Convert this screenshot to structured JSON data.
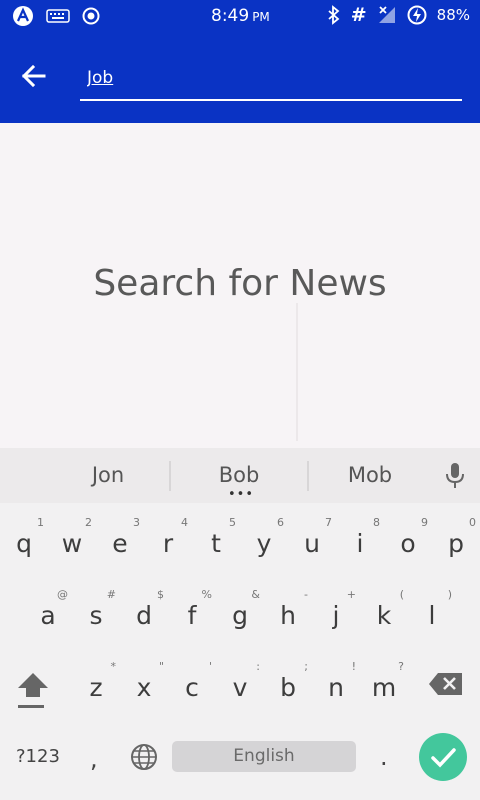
{
  "status_bar": {
    "time": "8:49",
    "ampm": "PM",
    "battery": "88%",
    "icons": [
      "app-icon",
      "keyboard-icon",
      "record-icon",
      "bluetooth-icon",
      "hash-icon",
      "no-signal-icon",
      "battery-charging-icon"
    ]
  },
  "app_bar": {
    "back_icon": "arrow-left-icon",
    "search_value": "Job"
  },
  "content": {
    "empty_message": "Search for News"
  },
  "keyboard": {
    "suggestions": [
      "Jon",
      "Bob",
      "Mob"
    ],
    "row1": [
      {
        "key": "q",
        "hint": "1"
      },
      {
        "key": "w",
        "hint": "2"
      },
      {
        "key": "e",
        "hint": "3"
      },
      {
        "key": "r",
        "hint": "4"
      },
      {
        "key": "t",
        "hint": "5"
      },
      {
        "key": "y",
        "hint": "6"
      },
      {
        "key": "u",
        "hint": "7"
      },
      {
        "key": "i",
        "hint": "8"
      },
      {
        "key": "o",
        "hint": "9"
      },
      {
        "key": "p",
        "hint": "0"
      }
    ],
    "row2": [
      {
        "key": "a",
        "hint": "@"
      },
      {
        "key": "s",
        "hint": "#"
      },
      {
        "key": "d",
        "hint": "$"
      },
      {
        "key": "f",
        "hint": "%"
      },
      {
        "key": "g",
        "hint": "&"
      },
      {
        "key": "h",
        "hint": "-"
      },
      {
        "key": "j",
        "hint": "+"
      },
      {
        "key": "k",
        "hint": "("
      },
      {
        "key": "l",
        "hint": ")"
      }
    ],
    "row3": [
      {
        "key": "z",
        "hint": "*"
      },
      {
        "key": "x",
        "hint": "\""
      },
      {
        "key": "c",
        "hint": "'"
      },
      {
        "key": "v",
        "hint": ":"
      },
      {
        "key": "b",
        "hint": ";"
      },
      {
        "key": "n",
        "hint": "!"
      },
      {
        "key": "m",
        "hint": "?"
      }
    ],
    "symbols_label": "?123",
    "comma": ",",
    "period": ".",
    "space_label": "English"
  }
}
